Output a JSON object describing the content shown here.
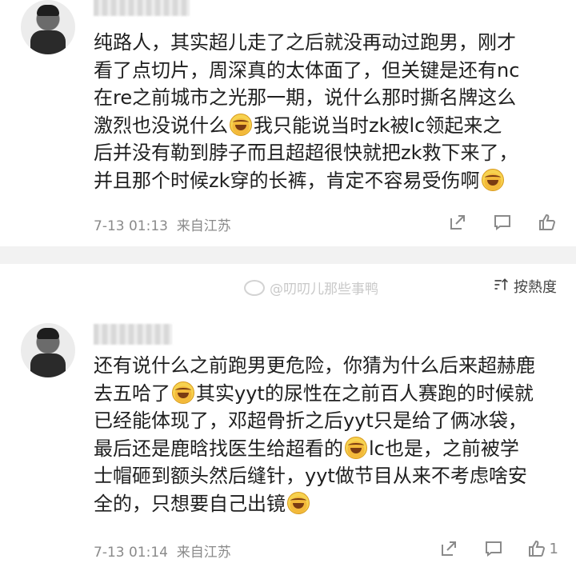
{
  "comments": [
    {
      "lines": [
        "纯路人，其实超儿走了之后就没再动过跑男，刚才",
        "看了点切片，周深真的太体面了，但关键是还有nc",
        "在re之前城市之光那一期，说什么那时撕名牌这么",
        "激烈也没说什么",
        "我只能说当时zk被lc领起来之",
        "后并没有勒到脖子而且超超很快就把zk救下来了，",
        "并且那个时候zk穿的长裤，肯定不容易受伤啊"
      ],
      "time": "7-13 01:13",
      "location": "来自江苏"
    },
    {
      "lines": [
        "还有说什么之前跑男更危险，你猜为什么后来超赫鹿",
        "去五哈了",
        "其实yyt的尿性在之前百人赛跑的时候就",
        "已经能体现了，邓超骨折之后yyt只是给了俩冰袋，",
        "最后还是鹿晗找医生给超看的",
        "lc也是，之前被学",
        "士帽砸到额头然后缝针，yyt做节目从来不考虑啥安",
        "全的，只想要自己出镜"
      ],
      "time": "7-13 01:14",
      "location": "来自江苏",
      "like_count": "1"
    }
  ],
  "watermark": "@叨叨儿那些事鸭",
  "sort_label": "按熱度",
  "icons": [
    "share-icon",
    "comment-icon",
    "like-icon",
    "sort-icon",
    "weibo-icon",
    "laugh-cry-emoji"
  ]
}
